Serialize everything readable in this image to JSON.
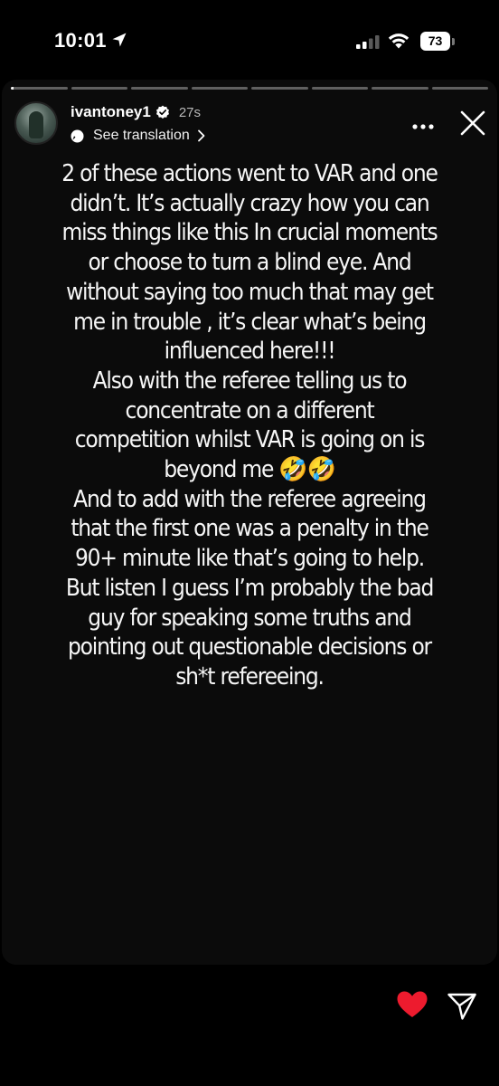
{
  "status_bar": {
    "time": "10:01",
    "battery_percent": "73",
    "location_icon": "location-arrow-icon",
    "signal_icon": "cellular-signal-icon",
    "wifi_icon": "wifi-icon"
  },
  "story": {
    "segments_total": 8,
    "active_segment": 0,
    "active_progress": 0.05,
    "username": "ivantoney1",
    "verified": true,
    "time_ago": "27s",
    "translation_label": "See translation",
    "text_lines": [
      "2 of these actions went to VAR and one",
      "didn’t. It’s actually crazy how you can",
      "miss things like this In crucial moments",
      "or choose to turn a blind eye. And",
      "without saying too much that may get",
      "me in trouble , it’s clear what’s being",
      "influenced here!!!",
      "Also with the referee telling us to",
      "concentrate on a different",
      "competition whilst VAR is going on is",
      "beyond me 🤣🤣",
      "And to add with the referee agreeing",
      "that the first one was a penalty in the",
      "90+ minute like that’s going to help.",
      "But listen I guess I’m probably the bad",
      "guy for speaking some truths and",
      "pointing out questionable decisions or",
      "sh*t refereeing."
    ]
  },
  "actions": {
    "liked": true,
    "heart_color": "#ed1b2e",
    "like_icon": "heart-icon",
    "share_icon": "paper-plane-icon"
  }
}
